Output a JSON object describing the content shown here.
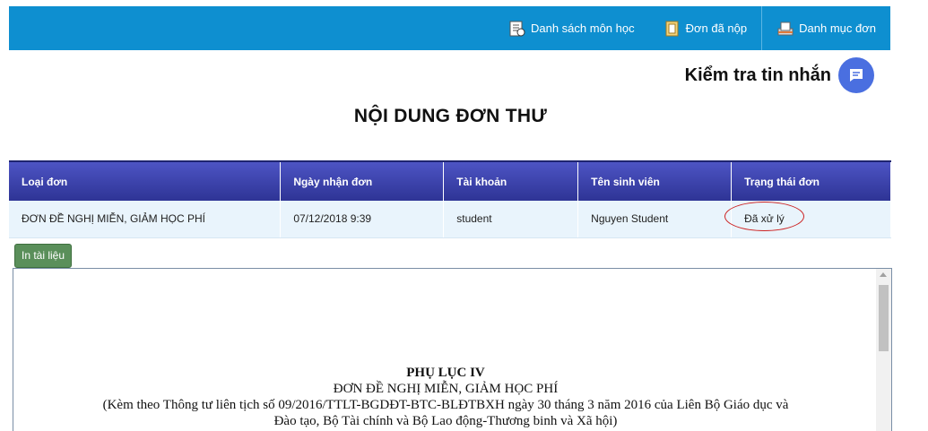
{
  "nav": {
    "items": [
      {
        "label": "Danh sách môn học",
        "icon": "subject-list-icon"
      },
      {
        "label": "Đơn đã nộp",
        "icon": "submitted-forms-icon"
      },
      {
        "label": "Danh mục đơn",
        "icon": "form-catalog-icon"
      }
    ]
  },
  "messages": {
    "label": "Kiểm tra tin nhắn",
    "icon": "chat-icon"
  },
  "page": {
    "title": "NỘI DUNG ĐƠN THƯ"
  },
  "table": {
    "headers": [
      "Loại đơn",
      "Ngày nhận đơn",
      "Tài khoản",
      "Tên sinh viên",
      "Trạng thái đơn"
    ],
    "rows": [
      {
        "type": "ĐƠN ĐỀ NGHỊ MIỄN, GIẢM HỌC PHÍ",
        "date": "07/12/2018 9:39",
        "account": "student",
        "name": "Nguyen Student",
        "status": "Đã xử lý"
      }
    ]
  },
  "print_button": "In tài liệu",
  "document": {
    "heading": "PHỤ LỤC IV",
    "subheading": "ĐƠN ĐỀ NGHỊ MIỄN, GIẢM HỌC PHÍ",
    "line1": "(Kèm theo Thông tư liên tịch số 09/2016/TTLT-BGDĐT-BTC-BLĐTBXH ngày 30 tháng 3 năm 2016 của Liên Bộ Giáo dục và",
    "line2": "Đào tạo, Bộ Tài chính và Bộ Lao động-Thương binh và Xã hội)"
  },
  "colors": {
    "topbar": "#0e8fd0",
    "header": "#3a41ad",
    "button": "#5a8f5a",
    "annotation": "#cc2222"
  }
}
